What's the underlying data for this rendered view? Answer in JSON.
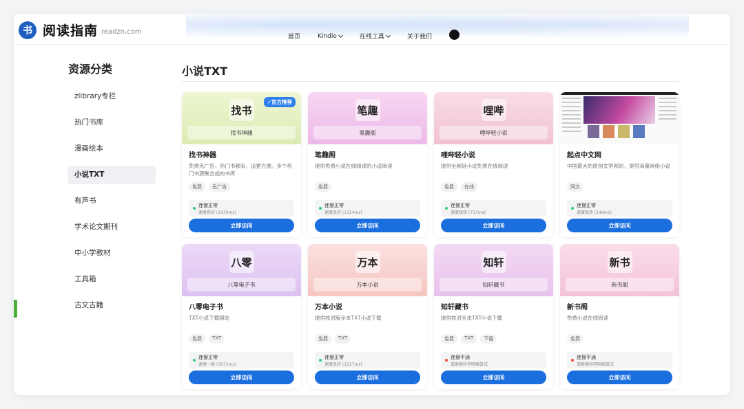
{
  "header": {
    "logo_mark": "书",
    "logo_title": "阅读指南",
    "logo_domain": "readzn.com",
    "nav": [
      {
        "label": "首页"
      },
      {
        "label": "Kindle"
      },
      {
        "label": "在线工具"
      },
      {
        "label": "关于我们"
      }
    ]
  },
  "sidebar": {
    "title": "资源分类",
    "items": [
      {
        "label": "zlibrary专栏"
      },
      {
        "label": "热门书库"
      },
      {
        "label": "漫画绘本"
      },
      {
        "label": "小说TXT"
      },
      {
        "label": "有声书"
      },
      {
        "label": "学术论文期刊"
      },
      {
        "label": "中小学教材"
      },
      {
        "label": "工具箱"
      },
      {
        "label": "古文古籍"
      }
    ],
    "active_index": 3
  },
  "main": {
    "title": "小说TXT",
    "visit_label": "立即访问",
    "cards": [
      {
        "banner_text": "找书",
        "banner_sub": "找书神器",
        "badge": "✓官方推荐",
        "title": "找书神器",
        "desc": "免费无广告，热门书都有，追更方便。多个热门书源聚合成的书库",
        "tags": [
          "免费",
          "无广告"
        ],
        "status": "连接正常",
        "speed": "速度良好 (1030ms)",
        "ok": true,
        "color_a": "#eef6d2",
        "color_b": "#dcecb4"
      },
      {
        "banner_text": "笔趣",
        "banner_sub": "笔趣阁",
        "title": "笔趣阁",
        "desc": "提供免费小说在线阅读的小说阅读",
        "tags": [
          "免费"
        ],
        "status": "连接正常",
        "speed": "速度良好 (1154ms)",
        "ok": true,
        "color_a": "#f8d7f2",
        "color_b": "#ecb8e8"
      },
      {
        "banner_text": "哩哔",
        "banner_sub": "哩哔轻小说",
        "title": "哩哔轻小说",
        "desc": "提供全网轻小说免费在线阅读",
        "tags": [
          "免费",
          "在线"
        ],
        "status": "连接正常",
        "speed": "速度极快 (717ms)",
        "ok": true,
        "color_a": "#f9dde6",
        "color_b": "#f2c1d2"
      },
      {
        "screenshot": true,
        "title": "起点中文网",
        "desc": "中国最大的原创文学网站，提供海量网络小说",
        "tags": [
          "网文"
        ],
        "status": "连接正常",
        "speed": "速度极快 (146ms)",
        "ok": true
      },
      {
        "banner_text": "八零",
        "banner_sub": "八零电子书",
        "title": "八零电子书",
        "desc": "TXT小说下载网站",
        "tags": [
          "免费",
          "TXT"
        ],
        "status": "连接正常",
        "speed": "速度一般 (3072ms)",
        "ok": true,
        "color_a": "#ecd9f7",
        "color_b": "#dcc1f1"
      },
      {
        "banner_text": "万本",
        "banner_sub": "万本小说",
        "title": "万本小说",
        "desc": "提供校对版全本TXT小说下载",
        "tags": [
          "免费",
          "TXT"
        ],
        "status": "连接正常",
        "speed": "速度良好 (1527ms)",
        "ok": true,
        "color_a": "#fbe1de",
        "color_b": "#f5c5c1"
      },
      {
        "banner_text": "知轩",
        "banner_sub": "知轩藏书",
        "title": "知轩藏书",
        "desc": "提供校对全本TXT小说下载",
        "tags": [
          "免费",
          "TXT",
          "下载"
        ],
        "status": "连接不通",
        "speed": "请更换科学网络尝试",
        "ok": false,
        "color_a": "#f3d9f3",
        "color_b": "#e8c2ee"
      },
      {
        "banner_text": "新书",
        "banner_sub": "新书阁",
        "title": "新书阁",
        "desc": "免费小说在线阅读",
        "tags": [
          "免费"
        ],
        "status": "连接不通",
        "speed": "请更换科学网络尝试",
        "ok": false,
        "color_a": "#fbdde9",
        "color_b": "#f3c2d9"
      }
    ]
  }
}
